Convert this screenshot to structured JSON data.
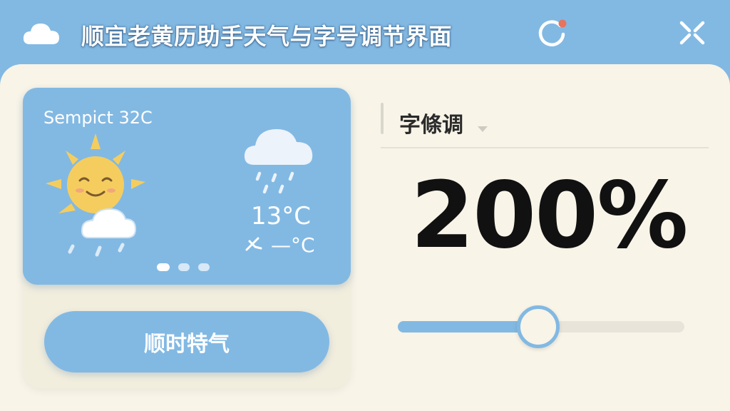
{
  "header": {
    "title": "顺宜老黄历助手天气与字号调节界面",
    "icons": {
      "logo": "cloud-icon",
      "refresh": "refresh-icon",
      "close": "close-icon"
    },
    "refresh_badge_color": "#e8735f"
  },
  "weather": {
    "location": "Sempict 32C",
    "temperature": "13°C",
    "wind": "—°C",
    "icons": {
      "main": "sun-cloud-icon",
      "forecast": "rain-cloud-icon",
      "wind": "wind-icon"
    },
    "page_count": 3,
    "active_page": 0
  },
  "button": {
    "label": "顺时特气"
  },
  "font_control": {
    "dropdown_label": "字條调",
    "scale_display": "200%",
    "slider_fraction": 0.49
  },
  "colors": {
    "accent": "#82b9e3",
    "panel": "#f8f4e8",
    "text_dark": "#111111"
  }
}
